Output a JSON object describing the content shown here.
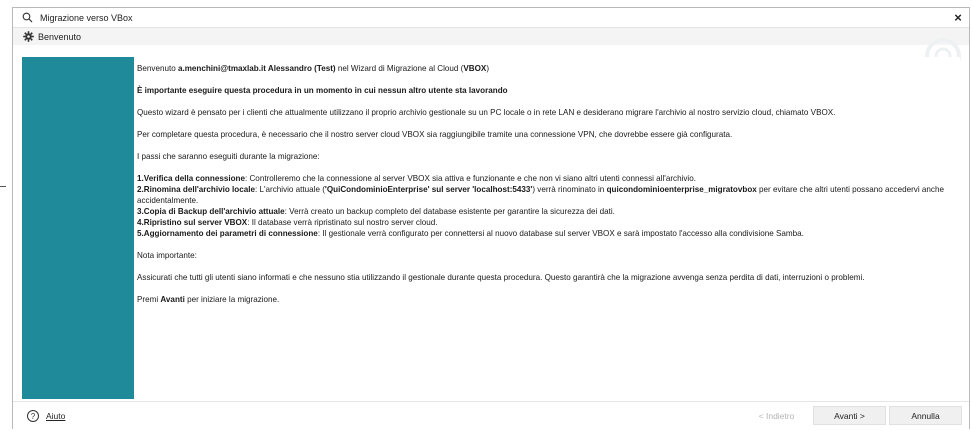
{
  "window": {
    "title": "Migrazione verso VBox",
    "close_label": "×"
  },
  "page": {
    "title": "Benvenuto"
  },
  "content": {
    "p1": {
      "before_user": "Benvenuto ",
      "user": "a.menchini@tmaxlab.it  Alessandro (Test)",
      "middle": " nel Wizard di Migrazione al Cloud (",
      "brand": "VBOX",
      "after": ")"
    },
    "warning": "È importante eseguire questa procedura in un momento in cui nessun altro utente sta lavorando",
    "intro": "Questo wizard è pensato per i clienti che attualmente utilizzano il proprio archivio gestionale su un PC locale o in rete LAN e desiderano migrare l'archivio al nostro servizio cloud, chiamato VBOX.",
    "requirement": "Per completare questa procedura, è necessario che il nostro server cloud VBOX sia raggiungibile tramite una connessione VPN, che dovrebbe essere già configurata.",
    "steps_intro": "I passi che saranno eseguiti durante la migrazione:",
    "steps": [
      {
        "title": "1.Verifica della connessione",
        "text": ": Controlleremo  che la connessione al server VBOX sia attiva e funzionante e che non vi siano altri utenti connessi all'archivio."
      },
      {
        "title": "2.Rinomina dell'archivio locale",
        "text_a": ": L'archivio attuale (",
        "bold_a": "'QuiCondominioEnterprise'  sul server 'localhost:5433'",
        "text_b": ") verrà rinominato in ",
        "bold_b": "quicondominioenterprise_migratovbox",
        "text_c": "  per evitare che altri utenti possano accedervi anche accidentalmente."
      },
      {
        "title": "3.Copia di Backup dell'archivio attuale",
        "text": ": Verrà  creato un backup completo del database esistente per garantire la sicurezza dei dati."
      },
      {
        "title": "4.Ripristino sul server VBOX",
        "text": ": Il database verrà ripristinato sul nostro server cloud."
      },
      {
        "title": "5.Aggiornamento  dei parametri di connessione",
        "text": ": Il gestionale verrà configurato per connettersi al nuovo database sul server VBOX e sarà impostato l'accesso alla condivisione Samba."
      }
    ],
    "note_title": "Nota importante:",
    "note": "Assicurati che tutti gli utenti siano informati e che nessuno stia utilizzando il gestionale durante questa procedura. Questo garantirà che la migrazione avvenga senza perdita di dati, interruzioni o problemi.",
    "final": {
      "before": "Premi ",
      "bold": "Avanti",
      "after": " per iniziare la migrazione."
    }
  },
  "footer": {
    "help_icon": "?",
    "help_label": "Aiuto",
    "back_label": "< Indietro",
    "next_label": "Avanti  >",
    "cancel_label": "Annulla"
  },
  "colors": {
    "sidebar": "#1f8a99"
  },
  "icons": {
    "title": "search-icon",
    "page": "gear-icon",
    "help": "help-circle-icon"
  }
}
